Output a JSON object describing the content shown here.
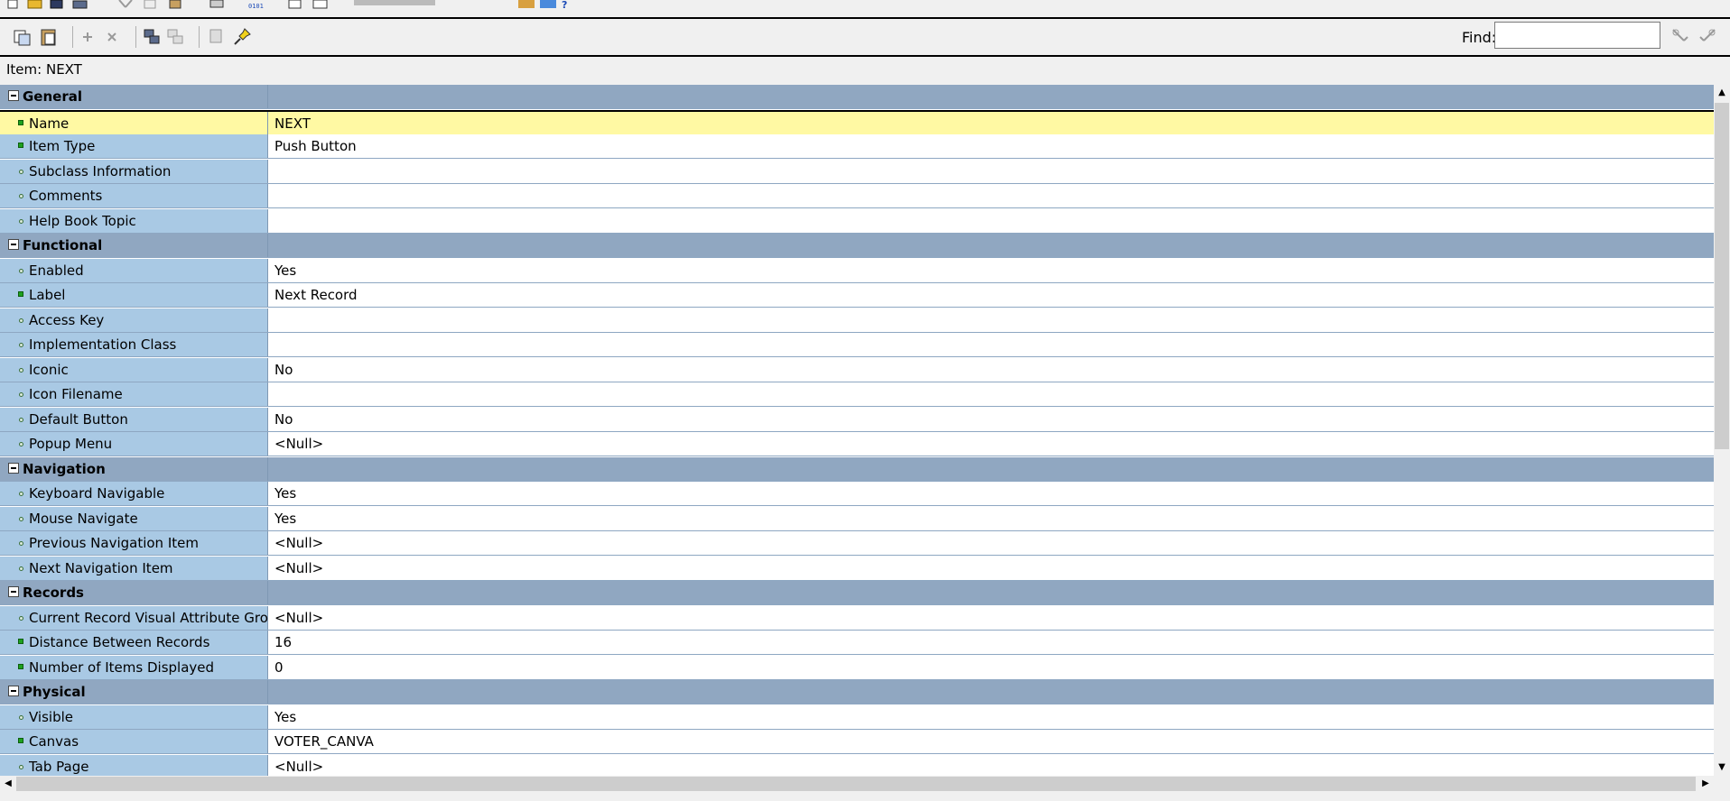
{
  "toolbar2": {
    "find_label": "Find:",
    "find_value": ""
  },
  "item_header": "Item: NEXT",
  "rows": [
    {
      "kind": "category",
      "label": "General"
    },
    {
      "kind": "prop",
      "label": "Name",
      "value": "NEXT",
      "marker": "changed",
      "selected": true
    },
    {
      "kind": "prop",
      "label": "Item Type",
      "value": "Push Button",
      "marker": "changed"
    },
    {
      "kind": "prop",
      "label": "Subclass Information",
      "value": "",
      "marker": "default"
    },
    {
      "kind": "prop",
      "label": "Comments",
      "value": "",
      "marker": "default"
    },
    {
      "kind": "prop",
      "label": "Help Book Topic",
      "value": "",
      "marker": "default"
    },
    {
      "kind": "category",
      "label": "Functional"
    },
    {
      "kind": "prop",
      "label": "Enabled",
      "value": "Yes",
      "marker": "default"
    },
    {
      "kind": "prop",
      "label": "Label",
      "value": "Next Record",
      "marker": "changed"
    },
    {
      "kind": "prop",
      "label": "Access Key",
      "value": "",
      "marker": "default"
    },
    {
      "kind": "prop",
      "label": "Implementation Class",
      "value": "",
      "marker": "default"
    },
    {
      "kind": "prop",
      "label": "Iconic",
      "value": "No",
      "marker": "default"
    },
    {
      "kind": "prop",
      "label": "Icon Filename",
      "value": "",
      "marker": "default"
    },
    {
      "kind": "prop",
      "label": "Default Button",
      "value": "No",
      "marker": "default"
    },
    {
      "kind": "prop",
      "label": "Popup Menu",
      "value": "<Null>",
      "marker": "default"
    },
    {
      "kind": "category",
      "label": "Navigation"
    },
    {
      "kind": "prop",
      "label": "Keyboard Navigable",
      "value": "Yes",
      "marker": "default"
    },
    {
      "kind": "prop",
      "label": "Mouse Navigate",
      "value": "Yes",
      "marker": "default"
    },
    {
      "kind": "prop",
      "label": "Previous Navigation Item",
      "value": "<Null>",
      "marker": "default"
    },
    {
      "kind": "prop",
      "label": "Next Navigation Item",
      "value": "<Null>",
      "marker": "default"
    },
    {
      "kind": "category",
      "label": "Records"
    },
    {
      "kind": "prop",
      "label": "Current Record Visual Attribute Group",
      "value": "<Null>",
      "marker": "default"
    },
    {
      "kind": "prop",
      "label": "Distance Between Records",
      "value": "16",
      "marker": "changed"
    },
    {
      "kind": "prop",
      "label": "Number of Items Displayed",
      "value": "0",
      "marker": "changed"
    },
    {
      "kind": "category",
      "label": "Physical"
    },
    {
      "kind": "prop",
      "label": "Visible",
      "value": "Yes",
      "marker": "default"
    },
    {
      "kind": "prop",
      "label": "Canvas",
      "value": "VOTER_CANVA",
      "marker": "changed"
    },
    {
      "kind": "prop",
      "label": "Tab Page",
      "value": "<Null>",
      "marker": "default"
    }
  ],
  "colors": {
    "category_bg": "#90a7c1",
    "name_col_bg": "#a9c9e4",
    "selected_bg": "#fff9a3",
    "changed_marker": "#1ea11e"
  },
  "icons": [
    "new-icon",
    "open-icon",
    "save-icon",
    "print-icon",
    "cut-icon",
    "copy-icon",
    "paste-icon",
    "undo-icon",
    "compile-icon",
    "run-icon",
    "debug-icon",
    "help-icon",
    "copy-properties-icon",
    "paste-properties-icon",
    "add-icon",
    "delete-icon",
    "union-icon",
    "intersection-icon",
    "inherit-icon",
    "pin-icon",
    "find-next-icon",
    "find-previous-icon"
  ]
}
